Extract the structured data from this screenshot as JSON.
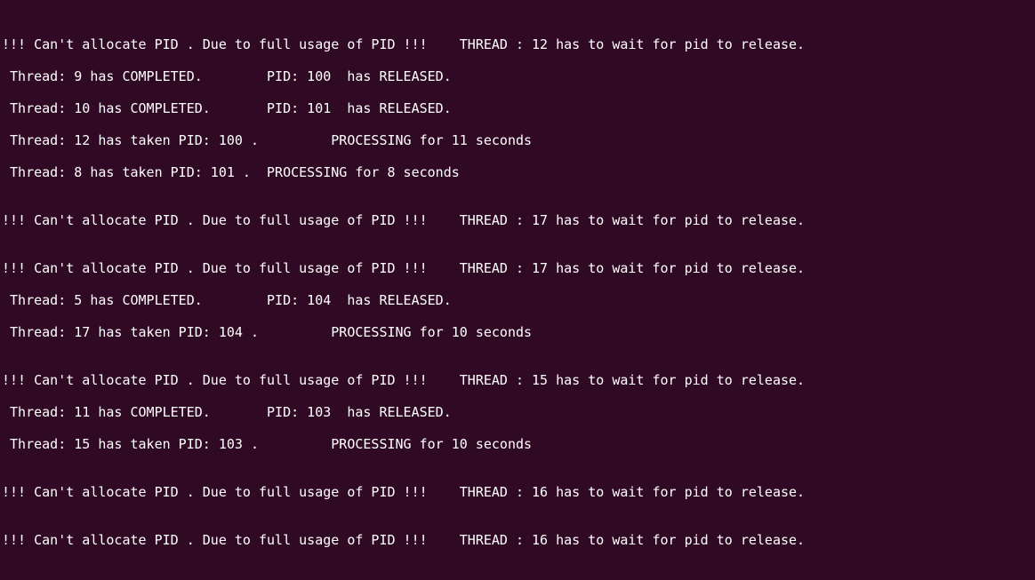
{
  "terminal": {
    "lines": [
      "!!! Can't allocate PID . Due to full usage of PID !!!    THREAD : 12 has to wait for pid to release.",
      " Thread: 9 has COMPLETED.        PID: 100  has RELEASED.",
      " Thread: 10 has COMPLETED.       PID: 101  has RELEASED.",
      " Thread: 12 has taken PID: 100 .         PROCESSING for 11 seconds",
      " Thread: 8 has taken PID: 101 .  PROCESSING for 8 seconds",
      "!!! Can't allocate PID . Due to full usage of PID !!!    THREAD : 17 has to wait for pid to release.",
      "!!! Can't allocate PID . Due to full usage of PID !!!    THREAD : 17 has to wait for pid to release.",
      " Thread: 5 has COMPLETED.        PID: 104  has RELEASED.",
      " Thread: 17 has taken PID: 104 .         PROCESSING for 10 seconds",
      "!!! Can't allocate PID . Due to full usage of PID !!!    THREAD : 15 has to wait for pid to release.",
      " Thread: 11 has COMPLETED.       PID: 103  has RELEASED.",
      " Thread: 15 has taken PID: 103 .         PROCESSING for 10 seconds",
      "!!! Can't allocate PID . Due to full usage of PID !!!    THREAD : 16 has to wait for pid to release.",
      "!!! Can't allocate PID . Due to full usage of PID !!!    THREAD : 16 has to wait for pid to release."
    ]
  }
}
